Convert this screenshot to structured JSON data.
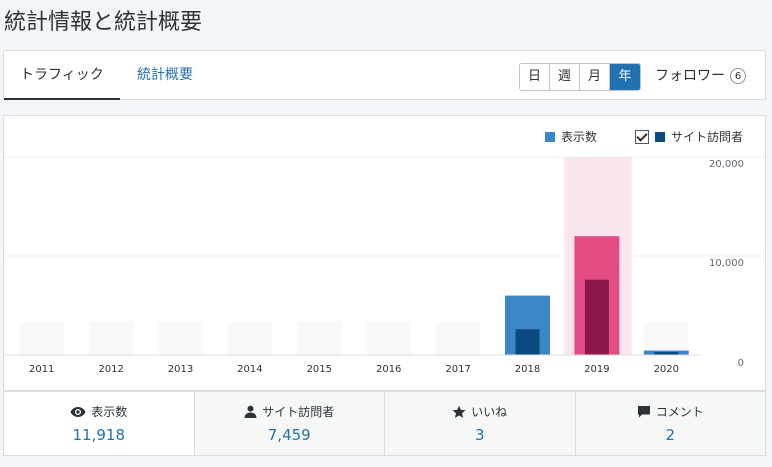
{
  "page": {
    "title": "統計情報と統計概要"
  },
  "tabs": [
    {
      "label": "トラフィック",
      "active": true
    },
    {
      "label": "統計概要",
      "active": false
    }
  ],
  "period": {
    "options": [
      "日",
      "週",
      "月",
      "年"
    ],
    "selected": "年"
  },
  "followers": {
    "label": "フォロワー",
    "count": "6"
  },
  "legend": {
    "views": {
      "label": "表示数",
      "color": "#3a86c8"
    },
    "visitors": {
      "label": "サイト訪問者",
      "color": "#0b4a7d",
      "checked": true
    }
  },
  "colors": {
    "accent": "#2271b1",
    "views_bar": "#3a86c8",
    "visitors_bar": "#0b4a7d",
    "selected_views_bar": "#e34c84",
    "selected_visitors_bar": "#8c1749",
    "selected_column_bg": "#fbe5ee"
  },
  "chart_data": {
    "type": "bar",
    "categories": [
      "2011",
      "2012",
      "2013",
      "2014",
      "2015",
      "2016",
      "2017",
      "2018",
      "2019",
      "2020"
    ],
    "series": [
      {
        "name": "表示数",
        "values": [
          0,
          0,
          0,
          0,
          0,
          0,
          0,
          6000,
          12000,
          450
        ]
      },
      {
        "name": "サイト訪問者",
        "values": [
          0,
          0,
          0,
          0,
          0,
          0,
          0,
          2600,
          7600,
          300
        ]
      }
    ],
    "selected_category": "2019",
    "ylim": [
      0,
      20000
    ],
    "yticks": [
      "0",
      "10,000",
      "20,000"
    ],
    "grid": true,
    "legend_position": "top-right"
  },
  "stats": [
    {
      "icon": "eye-icon",
      "label": "表示数",
      "value": "11,918",
      "active": true
    },
    {
      "icon": "person-icon",
      "label": "サイト訪問者",
      "value": "7,459",
      "active": false
    },
    {
      "icon": "star-icon",
      "label": "いいね",
      "value": "3",
      "active": false
    },
    {
      "icon": "comment-icon",
      "label": "コメント",
      "value": "2",
      "active": false
    }
  ]
}
